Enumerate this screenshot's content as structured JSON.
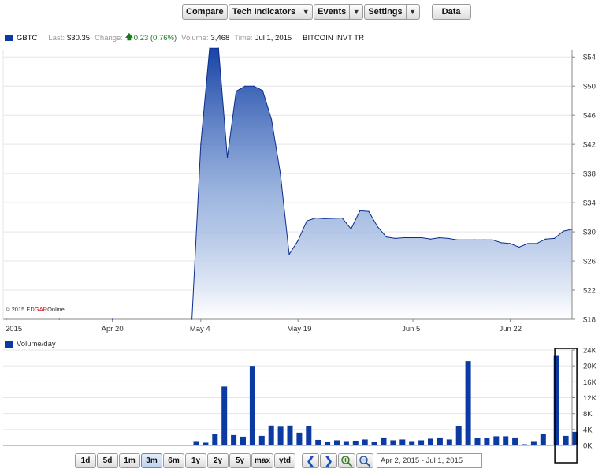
{
  "toolbar": {
    "compare": "Compare",
    "tech_indicators": "Tech Indicators",
    "events": "Events",
    "settings": "Settings",
    "data": "Data",
    "dropdown_icon": "chevron-down-icon"
  },
  "quote": {
    "symbol": "GBTC",
    "last_label": "Last:",
    "last_value": "$30.35",
    "change_label": "Change:",
    "change_value": "0.23 (0.76%)",
    "change_icon": "up-arrow-icon",
    "volume_label": "Volume:",
    "volume_value": "3,468",
    "time_label": "Time:",
    "time_value": "Jul 1, 2015",
    "name": "BITCOIN INVT TR"
  },
  "watermark": {
    "prefix": "© 2015 ",
    "brand": "EDGAR",
    "suffix": "Online"
  },
  "volume_legend": "Volume/day",
  "chart_data": [
    {
      "type": "area",
      "series": [
        {
          "name": "GBTC",
          "color": "#0b3aa2"
        }
      ],
      "x_tick_labels": [
        "2015",
        "Apr 20",
        "May 4",
        "May 19",
        "Jun 5",
        "Jun 22"
      ],
      "y_tick_labels": [
        "$18",
        "$22",
        "$26",
        "$30",
        "$34",
        "$38",
        "$42",
        "$46",
        "$50",
        "$54"
      ],
      "ylim": [
        18,
        55
      ],
      "grid": true,
      "points": [
        [
          "Apr 2",
          18.0
        ],
        [
          "Apr 10",
          18.0
        ],
        [
          "Apr 20",
          18.0
        ],
        [
          "May 1",
          18.0
        ],
        [
          "May 4",
          42
        ],
        [
          "May 5",
          55.2
        ],
        [
          "May 6",
          55.2
        ],
        [
          "May 7",
          40.2
        ],
        [
          "May 8",
          49.3
        ],
        [
          "May 11",
          50
        ],
        [
          "May 12",
          50
        ],
        [
          "May 13",
          49.4
        ],
        [
          "May 14",
          45.4
        ],
        [
          "May 15",
          38
        ],
        [
          "May 18",
          26.9
        ],
        [
          "May 19",
          28.8
        ],
        [
          "May 20",
          31.5
        ],
        [
          "May 21",
          31.9
        ],
        [
          "May 22",
          31.8
        ],
        [
          "May 26",
          31.9
        ],
        [
          "May 27",
          30.4
        ],
        [
          "May 28",
          32.9
        ],
        [
          "May 29",
          32.8
        ],
        [
          "Jun 1",
          30.7
        ],
        [
          "Jun 2",
          29.3
        ],
        [
          "Jun 3",
          29.1
        ],
        [
          "Jun 4",
          29.2
        ],
        [
          "Jun 5",
          29.2
        ],
        [
          "Jun 8",
          29.2
        ],
        [
          "Jun 9",
          29.0
        ],
        [
          "Jun 10",
          29.2
        ],
        [
          "Jun 11",
          29.1
        ],
        [
          "Jun 12",
          28.9
        ],
        [
          "Jun 15",
          28.9
        ],
        [
          "Jun 16",
          28.9
        ],
        [
          "Jun 17",
          28.9
        ],
        [
          "Jun 18",
          28.9
        ],
        [
          "Jun 19",
          28.5
        ],
        [
          "Jun 22",
          28.4
        ],
        [
          "Jun 23",
          27.9
        ],
        [
          "Jun 24",
          28.4
        ],
        [
          "Jun 25",
          28.4
        ],
        [
          "Jun 26",
          29.0
        ],
        [
          "Jun 29",
          29.1
        ],
        [
          "Jun 30",
          30.1
        ],
        [
          "Jul 1",
          30.35
        ]
      ]
    },
    {
      "type": "bar",
      "series": [
        {
          "name": "Volume/day",
          "color": "#0b3aa2"
        }
      ],
      "y_tick_labels": [
        "0K",
        "4K",
        "8K",
        "12K",
        "16K",
        "20K",
        "24K"
      ],
      "ylim": [
        0,
        24000
      ],
      "highlighted_bar_index": 39,
      "values": [
        900,
        700,
        2800,
        14800,
        2600,
        2200,
        20000,
        2400,
        5000,
        4700,
        5000,
        3200,
        4800,
        1400,
        800,
        1300,
        900,
        1200,
        1500,
        800,
        2000,
        1300,
        1500,
        900,
        1300,
        1700,
        2000,
        1500,
        4800,
        21200,
        1800,
        1900,
        2300,
        2300,
        2000,
        300,
        900,
        2900,
        22700,
        2400,
        3400
      ]
    }
  ],
  "range_buttons": [
    "1d",
    "5d",
    "1m",
    "3m",
    "6m",
    "1y",
    "2y",
    "5y",
    "max",
    "ytd"
  ],
  "active_range": "3m",
  "date_range": "Apr 2, 2015 - Jul 1, 2015"
}
